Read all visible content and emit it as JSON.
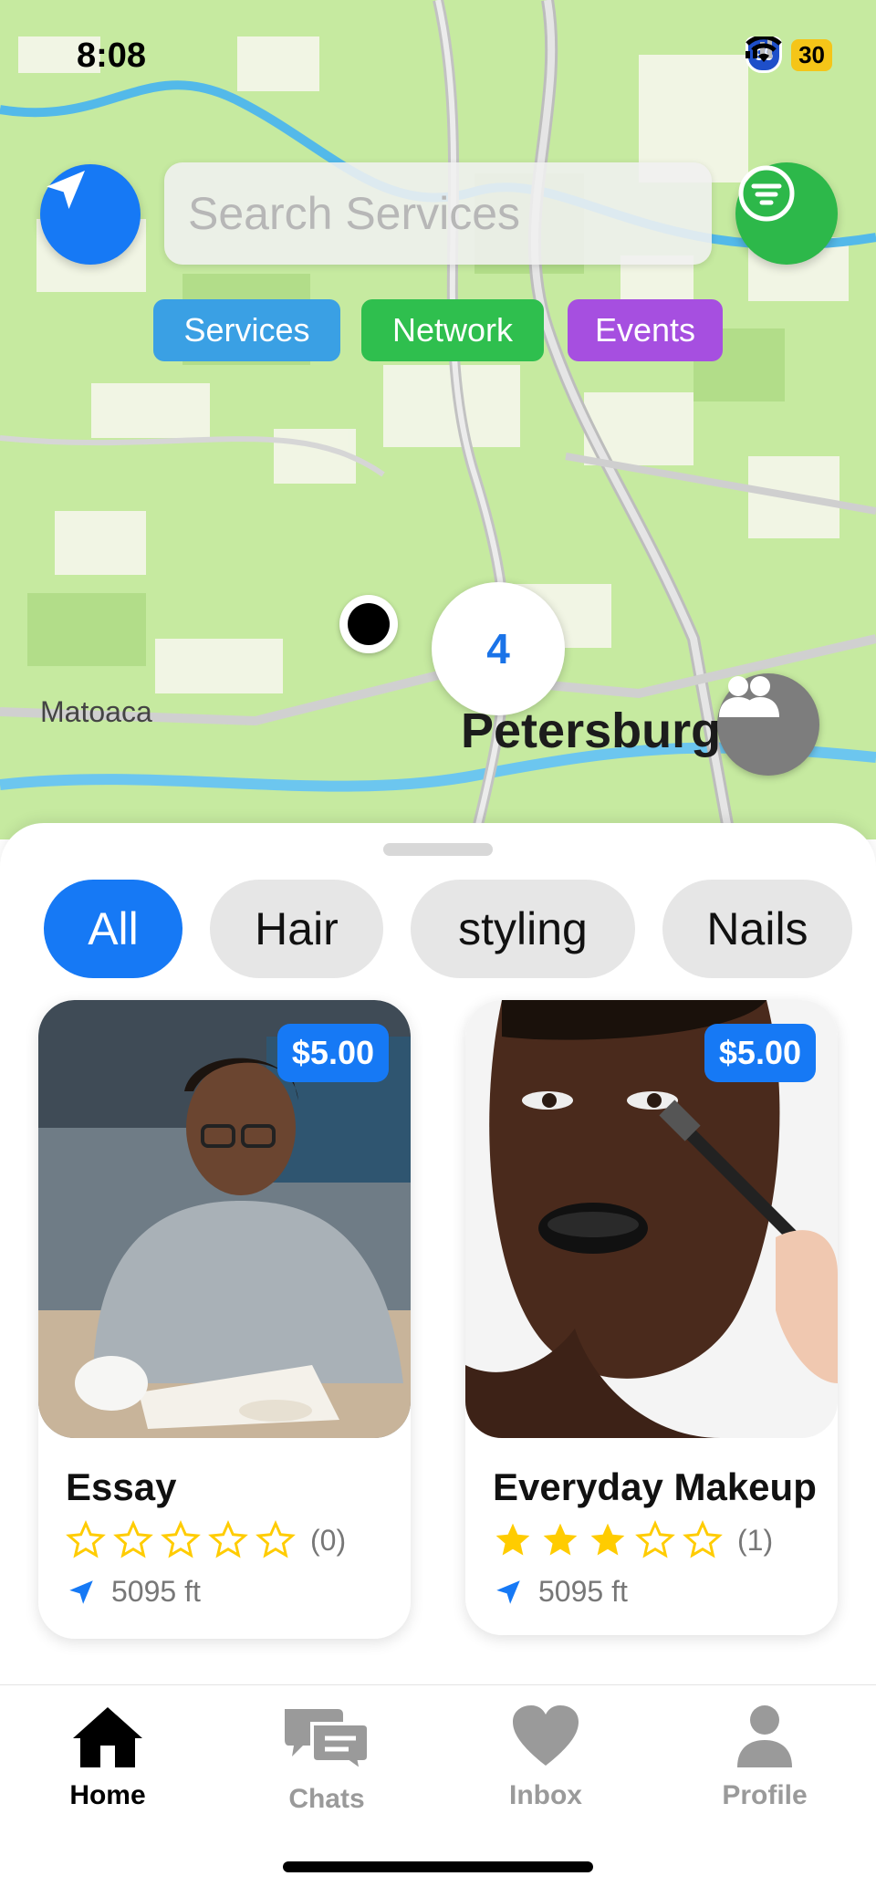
{
  "status_bar": {
    "time": "8:08",
    "highway_shield": "95",
    "battery": "30"
  },
  "map": {
    "search_placeholder": "Search Services",
    "chips": [
      {
        "label": "Services",
        "color": "#3aa0e4"
      },
      {
        "label": "Network",
        "color": "#2fbf4e"
      },
      {
        "label": "Events",
        "color": "#a64fe0"
      }
    ],
    "cluster_count": "4",
    "labels": {
      "small": "Matoaca",
      "big": "Petersburg"
    },
    "icons": {
      "locate": "location-arrow-icon",
      "filter": "filter-icon",
      "people": "people-icon"
    }
  },
  "categories": [
    {
      "label": "All",
      "active": true
    },
    {
      "label": "Hair",
      "active": false
    },
    {
      "label": "styling",
      "active": false
    },
    {
      "label": "Nails",
      "active": false
    }
  ],
  "cards": [
    {
      "title": "Essay",
      "price": "$5.00",
      "rating": 0,
      "rating_count": "(0)",
      "distance": "5095 ft"
    },
    {
      "title": "Everyday Makeup",
      "price": "$5.00",
      "rating": 3,
      "rating_count": "(1)",
      "distance": "5095 ft"
    }
  ],
  "tabs": [
    {
      "label": "Home",
      "icon": "home-icon",
      "active": true
    },
    {
      "label": "Chats",
      "icon": "chat-icon",
      "active": false
    },
    {
      "label": "Inbox",
      "icon": "heart-icon",
      "active": false
    },
    {
      "label": "Profile",
      "icon": "person-icon",
      "active": false
    }
  ],
  "colors": {
    "accent": "#1679f5",
    "filter_green": "#2db84a",
    "star": "#ffcc00"
  }
}
